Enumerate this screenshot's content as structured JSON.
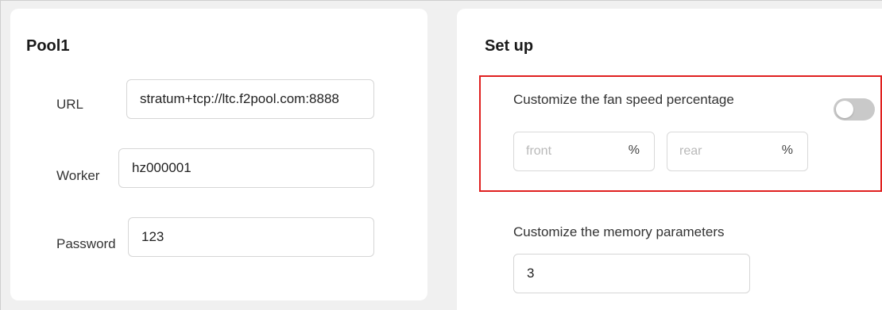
{
  "pool": {
    "title": "Pool1",
    "url_label": "URL",
    "url_value": "stratum+tcp://ltc.f2pool.com:8888",
    "worker_label": "Worker",
    "worker_value": "hz000001",
    "password_label": "Password",
    "password_value": "123"
  },
  "setup": {
    "title": "Set up",
    "fan_speed_label": "Customize the fan speed percentage",
    "fan_toggle_on": false,
    "front_placeholder": "front",
    "rear_placeholder": "rear",
    "percent_symbol": "%",
    "memory_label": "Customize the memory parameters",
    "memory_value": "3"
  },
  "colors": {
    "highlight_border": "#e0201f",
    "toggle_off": "#c9c9c9",
    "card_background": "#ffffff",
    "page_background": "#f0f0f0"
  }
}
